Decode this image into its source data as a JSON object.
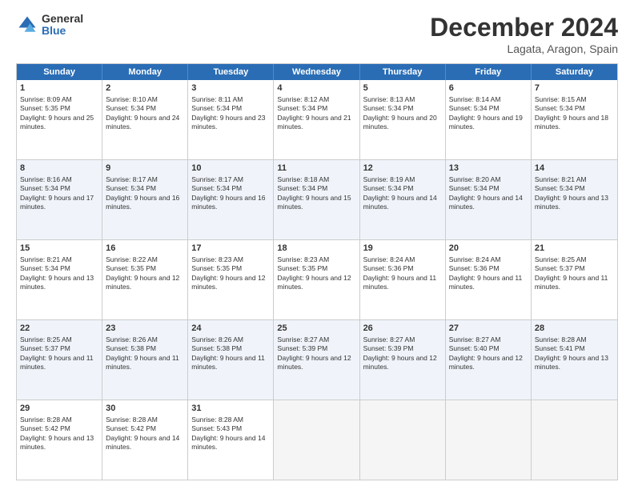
{
  "logo": {
    "general": "General",
    "blue": "Blue"
  },
  "title": {
    "month": "December 2024",
    "location": "Lagata, Aragon, Spain"
  },
  "header_days": [
    "Sunday",
    "Monday",
    "Tuesday",
    "Wednesday",
    "Thursday",
    "Friday",
    "Saturday"
  ],
  "weeks": [
    [
      {
        "day": "1",
        "sunrise": "Sunrise: 8:09 AM",
        "sunset": "Sunset: 5:35 PM",
        "daylight": "Daylight: 9 hours and 25 minutes."
      },
      {
        "day": "2",
        "sunrise": "Sunrise: 8:10 AM",
        "sunset": "Sunset: 5:34 PM",
        "daylight": "Daylight: 9 hours and 24 minutes."
      },
      {
        "day": "3",
        "sunrise": "Sunrise: 8:11 AM",
        "sunset": "Sunset: 5:34 PM",
        "daylight": "Daylight: 9 hours and 23 minutes."
      },
      {
        "day": "4",
        "sunrise": "Sunrise: 8:12 AM",
        "sunset": "Sunset: 5:34 PM",
        "daylight": "Daylight: 9 hours and 21 minutes."
      },
      {
        "day": "5",
        "sunrise": "Sunrise: 8:13 AM",
        "sunset": "Sunset: 5:34 PM",
        "daylight": "Daylight: 9 hours and 20 minutes."
      },
      {
        "day": "6",
        "sunrise": "Sunrise: 8:14 AM",
        "sunset": "Sunset: 5:34 PM",
        "daylight": "Daylight: 9 hours and 19 minutes."
      },
      {
        "day": "7",
        "sunrise": "Sunrise: 8:15 AM",
        "sunset": "Sunset: 5:34 PM",
        "daylight": "Daylight: 9 hours and 18 minutes."
      }
    ],
    [
      {
        "day": "8",
        "sunrise": "Sunrise: 8:16 AM",
        "sunset": "Sunset: 5:34 PM",
        "daylight": "Daylight: 9 hours and 17 minutes."
      },
      {
        "day": "9",
        "sunrise": "Sunrise: 8:17 AM",
        "sunset": "Sunset: 5:34 PM",
        "daylight": "Daylight: 9 hours and 16 minutes."
      },
      {
        "day": "10",
        "sunrise": "Sunrise: 8:17 AM",
        "sunset": "Sunset: 5:34 PM",
        "daylight": "Daylight: 9 hours and 16 minutes."
      },
      {
        "day": "11",
        "sunrise": "Sunrise: 8:18 AM",
        "sunset": "Sunset: 5:34 PM",
        "daylight": "Daylight: 9 hours and 15 minutes."
      },
      {
        "day": "12",
        "sunrise": "Sunrise: 8:19 AM",
        "sunset": "Sunset: 5:34 PM",
        "daylight": "Daylight: 9 hours and 14 minutes."
      },
      {
        "day": "13",
        "sunrise": "Sunrise: 8:20 AM",
        "sunset": "Sunset: 5:34 PM",
        "daylight": "Daylight: 9 hours and 14 minutes."
      },
      {
        "day": "14",
        "sunrise": "Sunrise: 8:21 AM",
        "sunset": "Sunset: 5:34 PM",
        "daylight": "Daylight: 9 hours and 13 minutes."
      }
    ],
    [
      {
        "day": "15",
        "sunrise": "Sunrise: 8:21 AM",
        "sunset": "Sunset: 5:34 PM",
        "daylight": "Daylight: 9 hours and 13 minutes."
      },
      {
        "day": "16",
        "sunrise": "Sunrise: 8:22 AM",
        "sunset": "Sunset: 5:35 PM",
        "daylight": "Daylight: 9 hours and 12 minutes."
      },
      {
        "day": "17",
        "sunrise": "Sunrise: 8:23 AM",
        "sunset": "Sunset: 5:35 PM",
        "daylight": "Daylight: 9 hours and 12 minutes."
      },
      {
        "day": "18",
        "sunrise": "Sunrise: 8:23 AM",
        "sunset": "Sunset: 5:35 PM",
        "daylight": "Daylight: 9 hours and 12 minutes."
      },
      {
        "day": "19",
        "sunrise": "Sunrise: 8:24 AM",
        "sunset": "Sunset: 5:36 PM",
        "daylight": "Daylight: 9 hours and 11 minutes."
      },
      {
        "day": "20",
        "sunrise": "Sunrise: 8:24 AM",
        "sunset": "Sunset: 5:36 PM",
        "daylight": "Daylight: 9 hours and 11 minutes."
      },
      {
        "day": "21",
        "sunrise": "Sunrise: 8:25 AM",
        "sunset": "Sunset: 5:37 PM",
        "daylight": "Daylight: 9 hours and 11 minutes."
      }
    ],
    [
      {
        "day": "22",
        "sunrise": "Sunrise: 8:25 AM",
        "sunset": "Sunset: 5:37 PM",
        "daylight": "Daylight: 9 hours and 11 minutes."
      },
      {
        "day": "23",
        "sunrise": "Sunrise: 8:26 AM",
        "sunset": "Sunset: 5:38 PM",
        "daylight": "Daylight: 9 hours and 11 minutes."
      },
      {
        "day": "24",
        "sunrise": "Sunrise: 8:26 AM",
        "sunset": "Sunset: 5:38 PM",
        "daylight": "Daylight: 9 hours and 11 minutes."
      },
      {
        "day": "25",
        "sunrise": "Sunrise: 8:27 AM",
        "sunset": "Sunset: 5:39 PM",
        "daylight": "Daylight: 9 hours and 12 minutes."
      },
      {
        "day": "26",
        "sunrise": "Sunrise: 8:27 AM",
        "sunset": "Sunset: 5:39 PM",
        "daylight": "Daylight: 9 hours and 12 minutes."
      },
      {
        "day": "27",
        "sunrise": "Sunrise: 8:27 AM",
        "sunset": "Sunset: 5:40 PM",
        "daylight": "Daylight: 9 hours and 12 minutes."
      },
      {
        "day": "28",
        "sunrise": "Sunrise: 8:28 AM",
        "sunset": "Sunset: 5:41 PM",
        "daylight": "Daylight: 9 hours and 13 minutes."
      }
    ],
    [
      {
        "day": "29",
        "sunrise": "Sunrise: 8:28 AM",
        "sunset": "Sunset: 5:42 PM",
        "daylight": "Daylight: 9 hours and 13 minutes."
      },
      {
        "day": "30",
        "sunrise": "Sunrise: 8:28 AM",
        "sunset": "Sunset: 5:42 PM",
        "daylight": "Daylight: 9 hours and 14 minutes."
      },
      {
        "day": "31",
        "sunrise": "Sunrise: 8:28 AM",
        "sunset": "Sunset: 5:43 PM",
        "daylight": "Daylight: 9 hours and 14 minutes."
      },
      null,
      null,
      null,
      null
    ]
  ]
}
